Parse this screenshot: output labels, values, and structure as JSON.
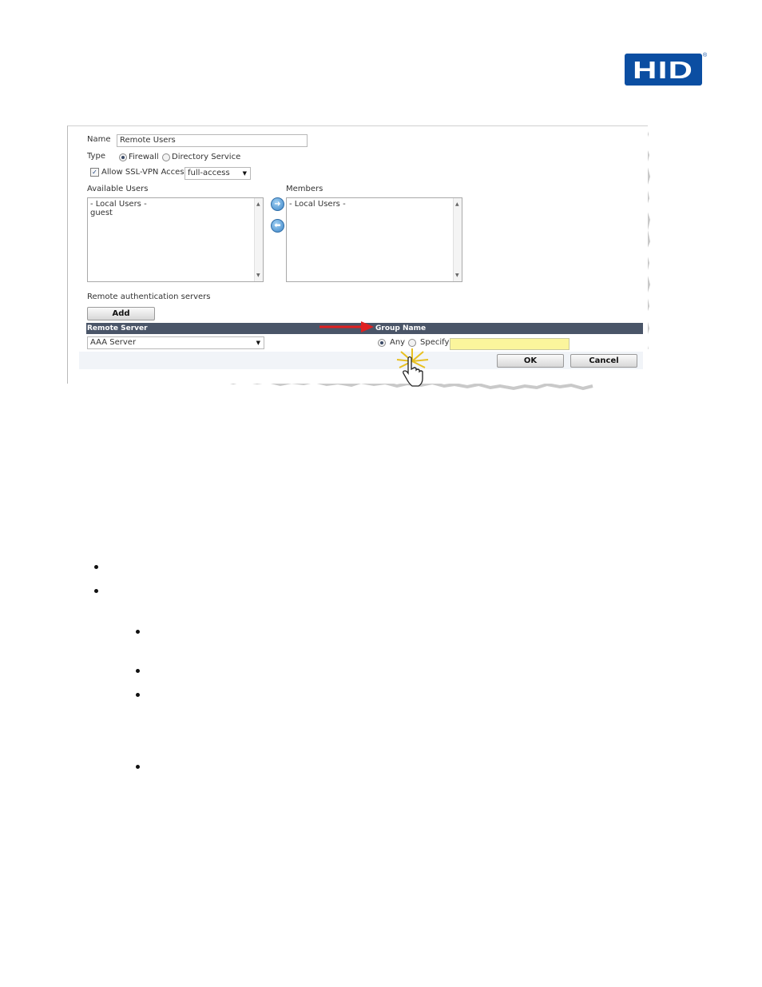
{
  "logo": {
    "text": "HID",
    "reg": "®"
  },
  "form": {
    "name_label": "Name",
    "name_value": "Remote Users",
    "type_label": "Type",
    "type_options": [
      "Firewall",
      "Directory Service"
    ],
    "type_selected": "Firewall",
    "ssl_vpn_label": "Allow SSL-VPN Access",
    "ssl_vpn_checked": true,
    "ssl_vpn_value": "full-access",
    "available_users_label": "Available Users",
    "available_users": [
      "- Local Users -",
      "guest"
    ],
    "members_label": "Members",
    "members": [
      "- Local Users -"
    ],
    "remote_auth_label": "Remote authentication servers",
    "add_button": "Add",
    "col_remote_server": "Remote Server",
    "col_group_name": "Group Name",
    "remote_server_value": "AAA Server",
    "group_any_label": "Any",
    "group_specify_label": "Specify",
    "group_selected": "Any",
    "ok_button": "OK",
    "cancel_button": "Cancel"
  },
  "colors": {
    "logo_blue": "#0b4ea2",
    "header_bar": "#4a5568",
    "highlight_yellow": "#fbf59c",
    "arrow_red": "#e02020"
  }
}
